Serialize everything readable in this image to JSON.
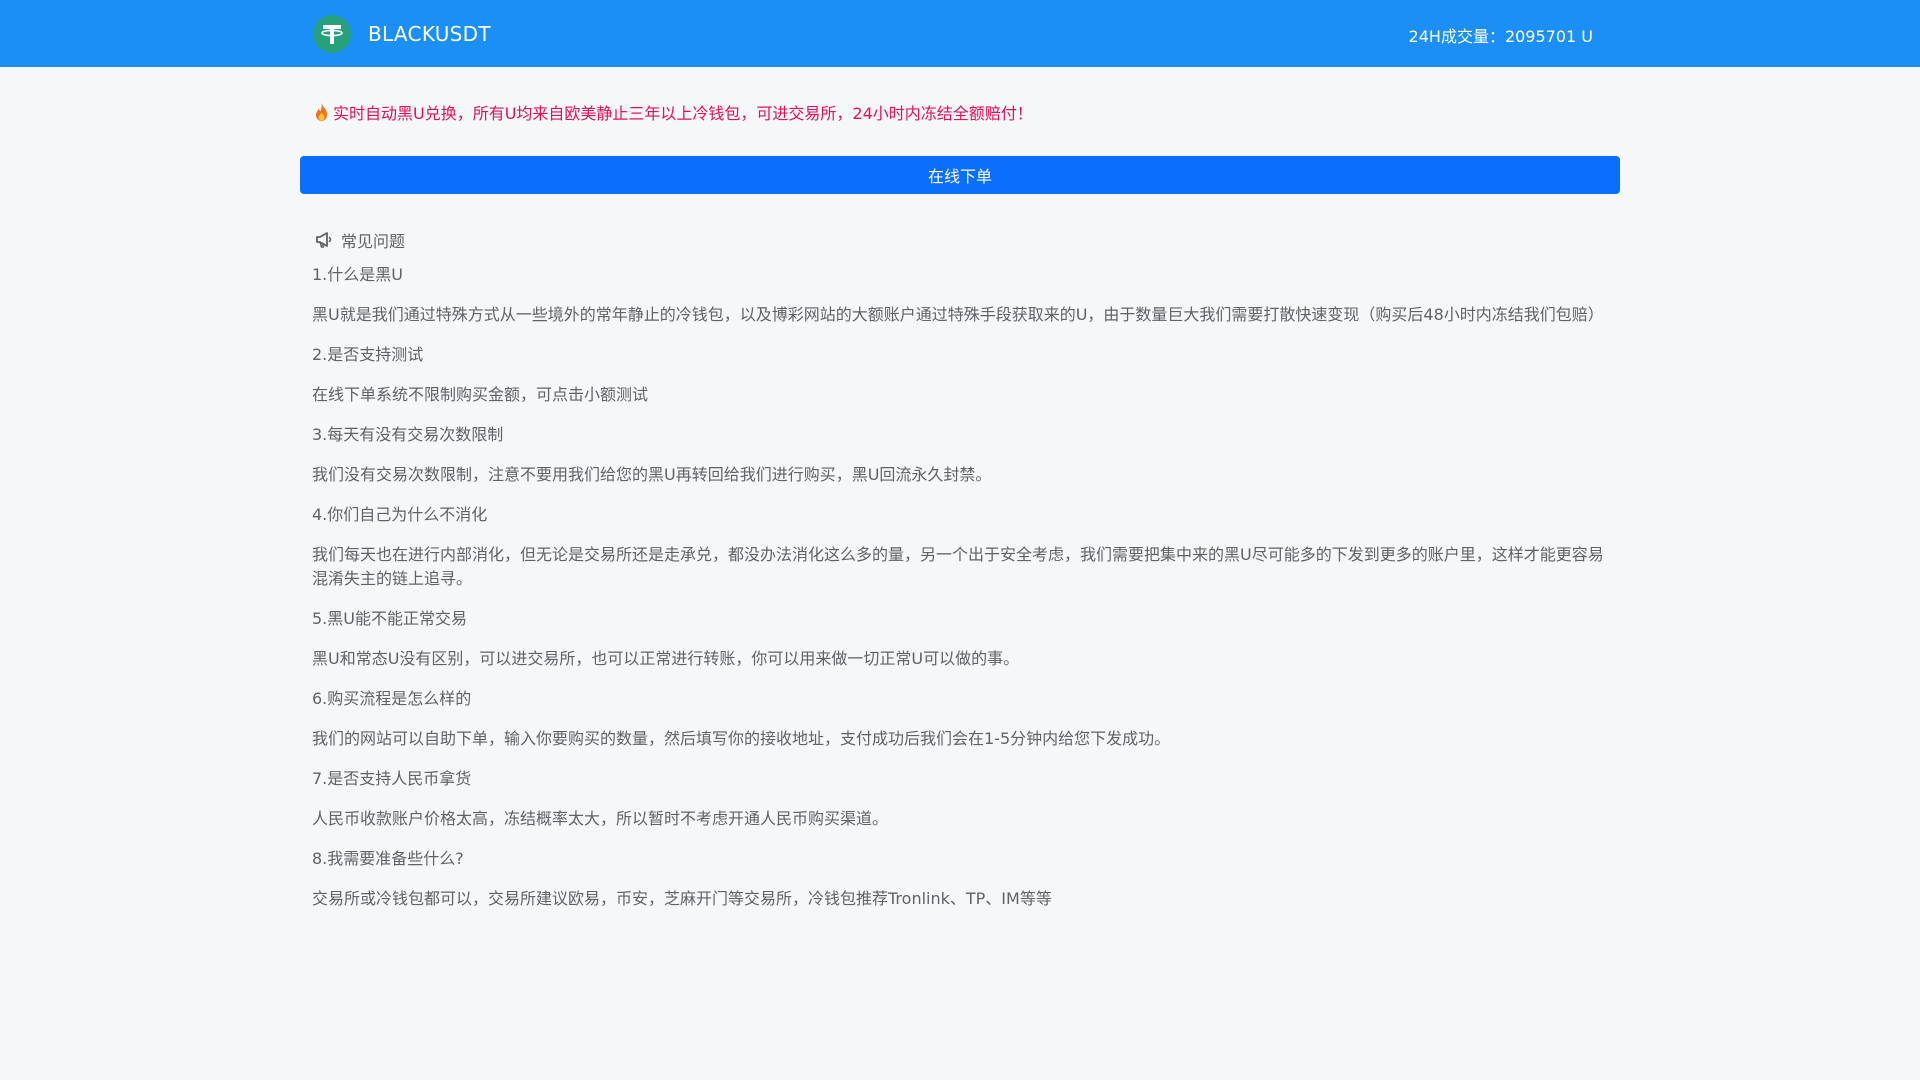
{
  "header": {
    "brand": "BLACKUSDT",
    "volume": "24H成交量：2095701 U"
  },
  "notice": "实时自动黑U兑换，所有U均来自欧美静止三年以上冷钱包，可进交易所，24小时内冻结全额赔付！",
  "order_button": "在线下单",
  "faq": {
    "title": "常见问题",
    "items": [
      {
        "q": "1.什么是黑U",
        "a": "黑U就是我们通过特殊方式从一些境外的常年静止的冷钱包，以及博彩网站的大额账户通过特殊手段获取来的U，由于数量巨大我们需要打散快速变现（购买后48小时内冻结我们包赔）"
      },
      {
        "q": "2.是否支持测试",
        "a": "在线下单系统不限制购买金额，可点击小额测试"
      },
      {
        "q": "3.每天有没有交易次数限制",
        "a": "我们没有交易次数限制，注意不要用我们给您的黑U再转回给我们进行购买，黑U回流永久封禁。"
      },
      {
        "q": "4.你们自己为什么不消化",
        "a": "我们每天也在进行内部消化，但无论是交易所还是走承兑，都没办法消化这么多的量，另一个出于安全考虑，我们需要把集中来的黑U尽可能多的下发到更多的账户里，这样才能更容易混淆失主的链上追寻。"
      },
      {
        "q": "5.黑U能不能正常交易",
        "a": "黑U和常态U没有区别，可以进交易所，也可以正常进行转账，你可以用来做一切正常U可以做的事。"
      },
      {
        "q": "6.购买流程是怎么样的",
        "a": "我们的网站可以自助下单，输入你要购买的数量，然后填写你的接收地址，支付成功后我们会在1-5分钟内给您下发成功。"
      },
      {
        "q": "7.是否支持人民币拿货",
        "a": "人民币收款账户价格太高，冻结概率太大，所以暂时不考虑开通人民币购买渠道。"
      },
      {
        "q": "8.我需要准备些什么?",
        "a": "交易所或冷钱包都可以，交易所建议欧易，币安，芝麻开门等交易所，冷钱包推荐Tronlink、TP、IM等等"
      }
    ]
  }
}
